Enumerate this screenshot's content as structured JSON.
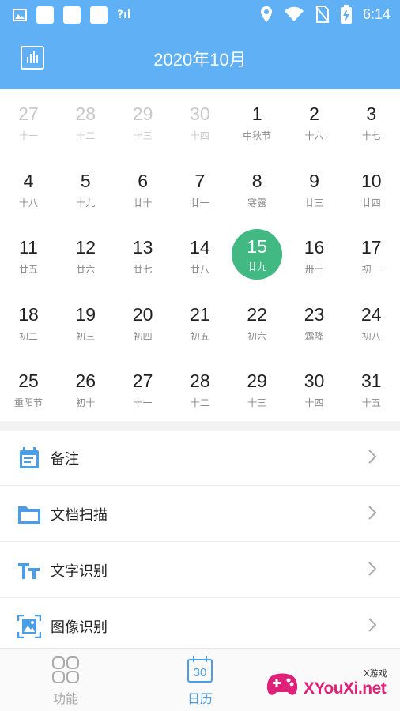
{
  "status_bar": {
    "time": "6:14",
    "signal_text": "?ıl",
    "icons": [
      "image-icon",
      "app-icon",
      "app-icon",
      "app-icon",
      "location-icon",
      "wifi-icon",
      "no-sim-icon",
      "battery-charging-icon"
    ]
  },
  "header": {
    "title": "2020年10月",
    "left_icon": "bar-chart-icon",
    "background": "#5fb0f5"
  },
  "calendar": {
    "selected_color": "#42b883",
    "days": [
      {
        "num": "27",
        "lunar": "十一",
        "muted": true
      },
      {
        "num": "28",
        "lunar": "十二",
        "muted": true
      },
      {
        "num": "29",
        "lunar": "十三",
        "muted": true
      },
      {
        "num": "30",
        "lunar": "十四",
        "muted": true
      },
      {
        "num": "1",
        "lunar": "中秋节",
        "muted": false
      },
      {
        "num": "2",
        "lunar": "十六",
        "muted": false
      },
      {
        "num": "3",
        "lunar": "十七",
        "muted": false
      },
      {
        "num": "4",
        "lunar": "十八",
        "muted": false
      },
      {
        "num": "5",
        "lunar": "十九",
        "muted": false
      },
      {
        "num": "6",
        "lunar": "廿十",
        "muted": false
      },
      {
        "num": "7",
        "lunar": "廿一",
        "muted": false
      },
      {
        "num": "8",
        "lunar": "寒露",
        "muted": false
      },
      {
        "num": "9",
        "lunar": "廿三",
        "muted": false
      },
      {
        "num": "10",
        "lunar": "廿四",
        "muted": false
      },
      {
        "num": "11",
        "lunar": "廿五",
        "muted": false
      },
      {
        "num": "12",
        "lunar": "廿六",
        "muted": false
      },
      {
        "num": "13",
        "lunar": "廿七",
        "muted": false
      },
      {
        "num": "14",
        "lunar": "廿八",
        "muted": false
      },
      {
        "num": "15",
        "lunar": "廿九",
        "muted": false,
        "selected": true
      },
      {
        "num": "16",
        "lunar": "卅十",
        "muted": false
      },
      {
        "num": "17",
        "lunar": "初一",
        "muted": false
      },
      {
        "num": "18",
        "lunar": "初二",
        "muted": false
      },
      {
        "num": "19",
        "lunar": "初三",
        "muted": false
      },
      {
        "num": "20",
        "lunar": "初四",
        "muted": false
      },
      {
        "num": "21",
        "lunar": "初五",
        "muted": false
      },
      {
        "num": "22",
        "lunar": "初六",
        "muted": false
      },
      {
        "num": "23",
        "lunar": "霜降",
        "muted": false
      },
      {
        "num": "24",
        "lunar": "初八",
        "muted": false
      },
      {
        "num": "25",
        "lunar": "重阳节",
        "muted": false
      },
      {
        "num": "26",
        "lunar": "初十",
        "muted": false
      },
      {
        "num": "27",
        "lunar": "十一",
        "muted": false
      },
      {
        "num": "28",
        "lunar": "十二",
        "muted": false
      },
      {
        "num": "29",
        "lunar": "十三",
        "muted": false
      },
      {
        "num": "30",
        "lunar": "十四",
        "muted": false
      },
      {
        "num": "31",
        "lunar": "十五",
        "muted": false
      }
    ]
  },
  "menu": {
    "icon_color": "#4a9ee8",
    "items": [
      {
        "label": "备注",
        "icon": "note-calendar-icon",
        "name": "menu-item-notes"
      },
      {
        "label": "文档扫描",
        "icon": "folder-icon",
        "name": "menu-item-document-scan"
      },
      {
        "label": "文字识别",
        "icon": "text-recognition-icon",
        "name": "menu-item-text-recognition"
      },
      {
        "label": "图像识别",
        "icon": "image-recognition-icon",
        "name": "menu-item-image-recognition"
      }
    ]
  },
  "bottom_nav": {
    "items": [
      {
        "label": "功能",
        "icon": "grid-icon",
        "active": false
      },
      {
        "label": "日历",
        "icon": "calendar-icon",
        "icon_text": "30",
        "active": true
      }
    ]
  },
  "watermark": {
    "brand": "XYouXi.net",
    "tag": "X游戏"
  }
}
